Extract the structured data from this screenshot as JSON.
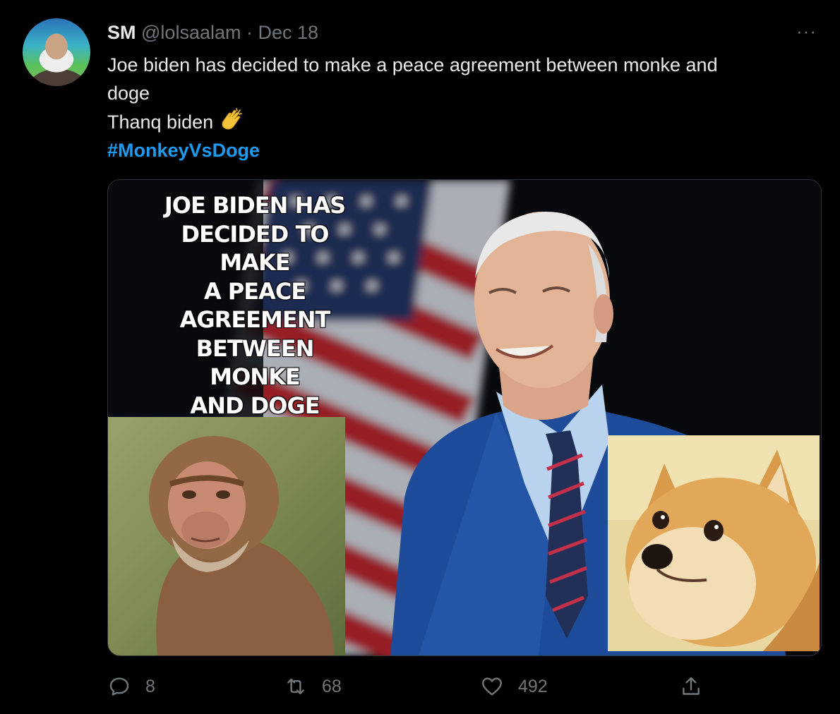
{
  "tweet": {
    "author_name": "SM",
    "handle": "@lolsaalam",
    "separator": "·",
    "date": "Dec 18",
    "more_label": "···",
    "text_line1": "Joe biden has decided to make a peace agreement between monke and",
    "text_line2": "doge",
    "text_line3": "Thanq biden",
    "hashtag": "#MonkeyVsDoge"
  },
  "media": {
    "caption_lines": [
      "JOE BIDEN HAS",
      "DECIDED TO",
      "MAKE",
      "A PEACE",
      "AGREEMENT",
      "BETWEEN",
      "MONKE",
      "AND DOGE"
    ]
  },
  "actions": {
    "reply_count": "8",
    "retweet_count": "68",
    "like_count": "492"
  },
  "colors": {
    "background": "#000000",
    "text": "#e7e9ea",
    "muted": "#71767b",
    "hashtag": "#1d9bf0"
  }
}
